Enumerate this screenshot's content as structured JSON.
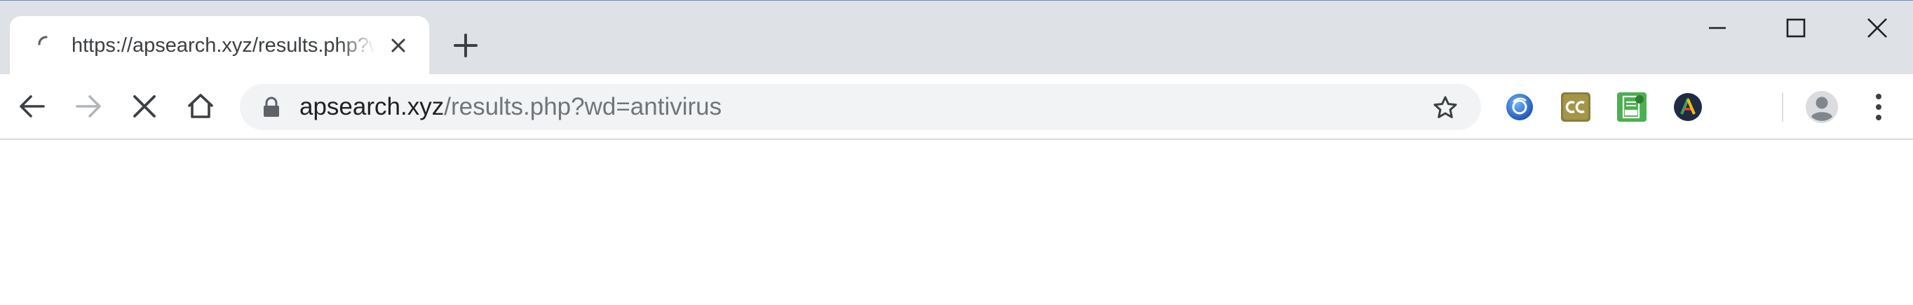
{
  "tab": {
    "title": "https://apsearch.xyz/results.php?wd=antivirus",
    "state": "loading"
  },
  "omnibox": {
    "host": "apsearch.xyz",
    "path": "/results.php?wd=antivirus",
    "secure": true
  },
  "icons": {
    "tab_spinner": "loading-spinner-icon",
    "tab_close": "close-icon",
    "new_tab": "plus-icon",
    "minimize": "minimize-icon",
    "maximize": "maximize-icon",
    "close_window": "close-window-icon",
    "back": "arrow-left-icon",
    "forward": "arrow-right-icon",
    "stop": "stop-icon",
    "home": "home-icon",
    "lock": "lock-icon",
    "bookmark": "star-icon",
    "profile": "avatar-icon",
    "menu": "kebab-menu-icon"
  },
  "extensions": [
    {
      "name": "search-extension-icon",
      "color": "#1a73e8"
    },
    {
      "name": "cc-extension-icon",
      "color": "#8b7d3a"
    },
    {
      "name": "pdf-extension-icon",
      "color": "#4caf50"
    },
    {
      "name": "a-extension-icon",
      "color": "#1f2a44"
    }
  ],
  "colors": {
    "tabstrip_bg": "#dee1e6",
    "omnibox_bg": "#f1f3f4",
    "url_host": "#202124",
    "url_path": "#70757a"
  }
}
